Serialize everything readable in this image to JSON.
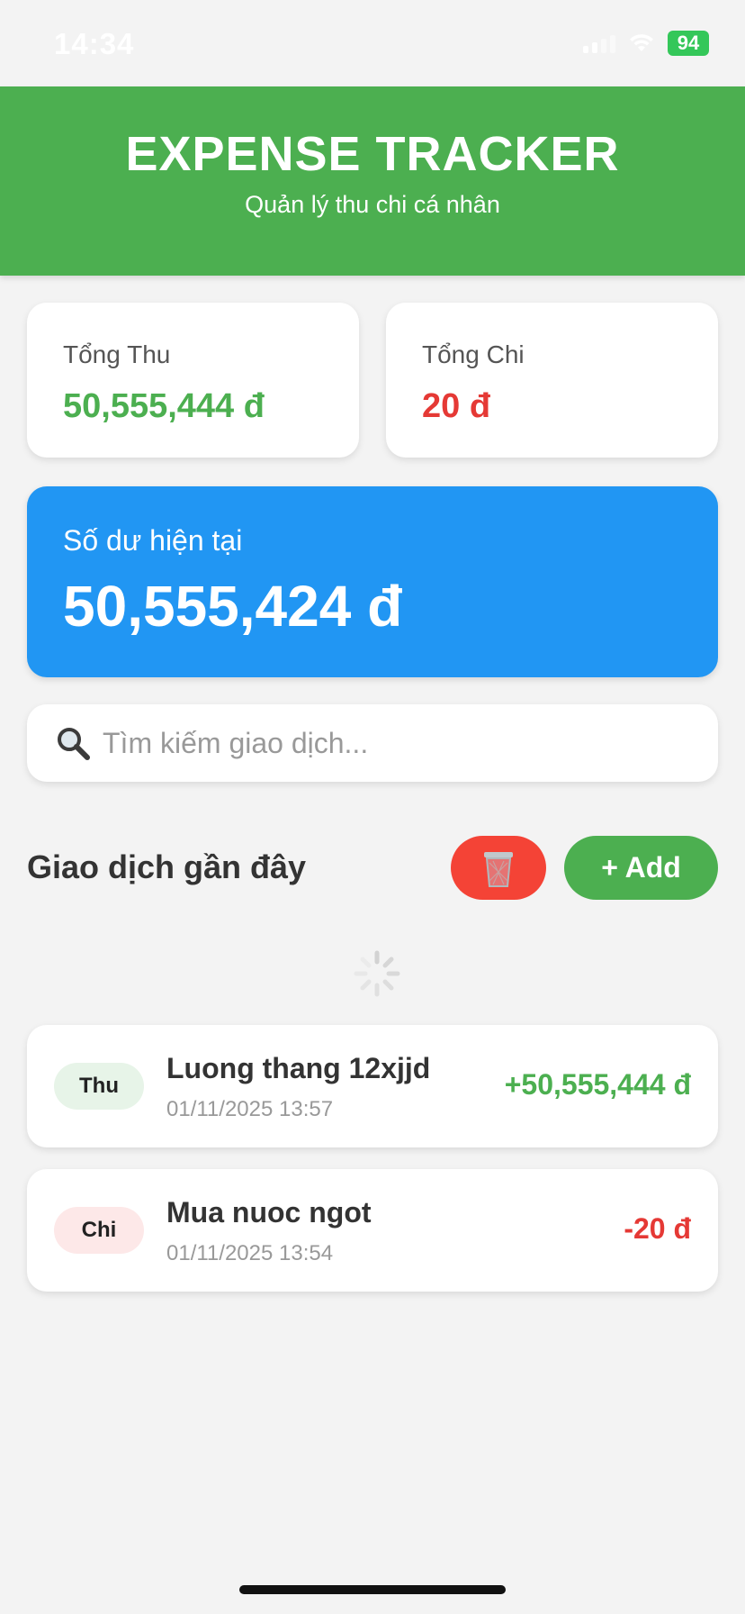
{
  "status_bar": {
    "time": "14:34",
    "battery": "94"
  },
  "header": {
    "title": "EXPENSE TRACKER",
    "subtitle": "Quản lý thu chi cá nhân"
  },
  "summary": {
    "income": {
      "label": "Tổng Thu",
      "value": "50,555,444 đ"
    },
    "expense": {
      "label": "Tổng Chi",
      "value": "20 đ"
    }
  },
  "balance": {
    "label": "Số dư hiện tại",
    "value": "50,555,424 đ"
  },
  "search": {
    "placeholder": "Tìm kiếm giao dịch...",
    "value": ""
  },
  "transactions_section": {
    "title": "Giao dịch gần đây",
    "add_label": "+ Add",
    "delete_icon": "trash-icon"
  },
  "transactions": [
    {
      "type": "Thu",
      "name": "Luong thang 12xjjd",
      "date": "01/11/2025 13:57",
      "amount": "+50,555,444 đ"
    },
    {
      "type": "Chi",
      "name": "Mua nuoc ngot",
      "date": "01/11/2025 13:54",
      "amount": "-20 đ"
    }
  ],
  "colors": {
    "header": "#4caf50",
    "income": "#4caf50",
    "expense": "#e53935",
    "balance_card": "#2196f3",
    "delete_button": "#f44336"
  }
}
